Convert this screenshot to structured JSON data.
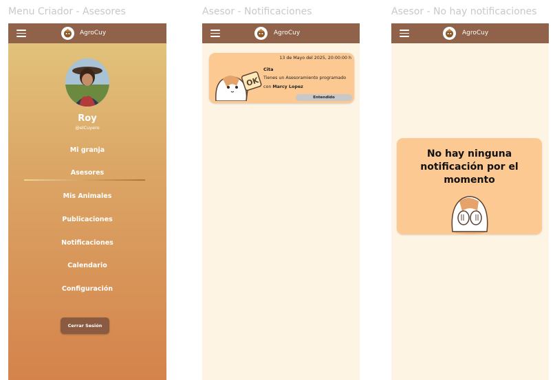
{
  "frames": {
    "menu_title": "Menu Criador - Asesores",
    "notif_title": "Asesor - Notificaciones",
    "empty_title": "Asesor - No hay notificaciones"
  },
  "app": {
    "name": "AgroCuy"
  },
  "profile": {
    "name": "Roy",
    "handle": "@elCuyero"
  },
  "menu": {
    "items": [
      "Mi granja",
      "Asesores",
      "Mis Animales",
      "Publicaciones",
      "Notificaciones",
      "Calendario",
      "Configuración"
    ],
    "active": "Asesores",
    "logout_label": "Cerrar Sesión"
  },
  "notification": {
    "date": "13 de Mayo del 2025, 20:00:00 h",
    "title": "Cita",
    "body": "Tienes un Asesoramiento programado",
    "body_prefix": "con",
    "person": "Marcy Lopez",
    "ack_label": "Entendido"
  },
  "empty_state": {
    "message": "No hay ninguna notificación por el momento"
  },
  "colors": {
    "appbar": "#8f6249",
    "card": "#fdc992",
    "background": "#fdf4e4",
    "button": "#8a5a41"
  }
}
